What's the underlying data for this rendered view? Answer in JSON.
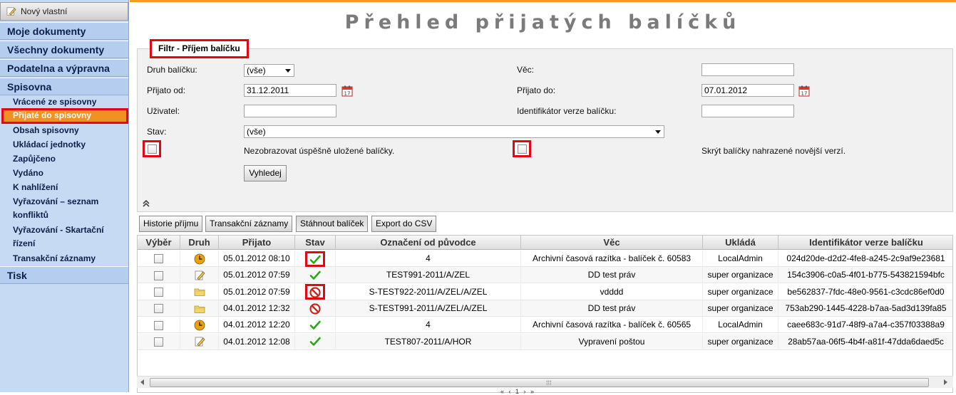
{
  "sidebar": {
    "new_button": "Nový vlastní",
    "main_items": [
      "Moje dokumenty",
      "Všechny dokumenty",
      "Podatelna a výpravna",
      "Spisovna"
    ],
    "sub_items": [
      "Vrácené ze spisovny",
      "Přijaté do spisovny",
      "Obsah spisovny",
      "Ukládací jednotky",
      "Zapůjčeno",
      "Vydáno",
      "K nahlížení",
      "Vyřazování – seznam",
      "konfliktů",
      "Vyřazování - Skartační",
      "řízení",
      "Transakční záznamy"
    ],
    "active_sub": "Přijaté do spisovny",
    "last_item": "Tisk"
  },
  "page": {
    "title": "Přehled přijatých balíčků"
  },
  "filter": {
    "legend": "Filtr - Příjem balíčku",
    "druh_label": "Druh balíčku:",
    "druh_value": "(vše)",
    "vec_label": "Věc:",
    "vec_value": "",
    "prijato_od_label": "Přijato od:",
    "prijato_od_value": "31.12.2011",
    "prijato_do_label": "Přijato do:",
    "prijato_do_value": "07.01.2012",
    "uzivatel_label": "Uživatel:",
    "uzivatel_value": "",
    "ident_label": "Identifikátor verze balíčku:",
    "ident_value": "",
    "stav_label": "Stav:",
    "stav_value": "(vše)",
    "chk1_label": "Nezobrazovat úspěšně uložené balíčky.",
    "chk2_label": "Skrýt balíčky nahrazené novější verzí.",
    "search_button": "Vyhledej"
  },
  "toolbar": {
    "history": "Historie příjmu",
    "transactions": "Transakční záznamy",
    "download": "Stáhnout balíček",
    "export": "Export do CSV"
  },
  "grid": {
    "columns": [
      "Výběr",
      "Druh",
      "Přijato",
      "Stav",
      "Označení od původce",
      "Věc",
      "Ukládá",
      "Identifikátor verze balíčku"
    ],
    "rows": [
      {
        "druh": "clock-icon",
        "prijato": "05.01.2012 08:10",
        "stav": "ok",
        "oznaceni": "4",
        "vec": "Archivní časová razítka - balíček č. 60583",
        "uklada": "LocalAdmin",
        "ident": "024d20de-d2d2-4fe8-a245-2c9af9e23681"
      },
      {
        "druh": "pencil-icon",
        "prijato": "05.01.2012 07:59",
        "stav": "ok",
        "oznaceni": "TEST991-2011/A/ZEL",
        "vec": "DD test práv",
        "uklada": "super organizace",
        "ident": "154c3906-c0a5-4f01-b775-543821594bfc"
      },
      {
        "druh": "folder-icon",
        "prijato": "05.01.2012 07:59",
        "stav": "error",
        "oznaceni": "S-TEST922-2011/A/ZEL/A/ZEL",
        "vec": "vdddd",
        "uklada": "super organizace",
        "ident": "be562837-7fdc-48e0-9561-c3cdc86ef0d0"
      },
      {
        "druh": "folder-icon",
        "prijato": "04.01.2012 12:32",
        "stav": "error",
        "oznaceni": "S-TEST991-2011/A/ZEL/A/ZEL",
        "vec": "DD test práv",
        "uklada": "super organizace",
        "ident": "753ab290-1445-4228-b7aa-5ad3d139fa85"
      },
      {
        "druh": "clock-icon",
        "prijato": "04.01.2012 12:20",
        "stav": "ok",
        "oznaceni": "4",
        "vec": "Archivní časová razítka - balíček č. 60565",
        "uklada": "LocalAdmin",
        "ident": "caee683c-91d7-48f9-a7a4-c357f03388a9"
      },
      {
        "druh": "pencil-icon",
        "prijato": "04.01.2012 12:08",
        "stav": "ok",
        "oznaceni": "TEST807-2011/A/HOR",
        "vec": "Vypravení poštou",
        "uklada": "super organizace",
        "ident": "28ab57aa-06f5-4b4f-a81f-47dda6daed5c"
      }
    ]
  },
  "colors": {
    "accent_orange": "#f09222",
    "highlight_red": "#e30613",
    "sidebar_bg": "#c7daf3",
    "title_gray": "#7b7b7b"
  }
}
